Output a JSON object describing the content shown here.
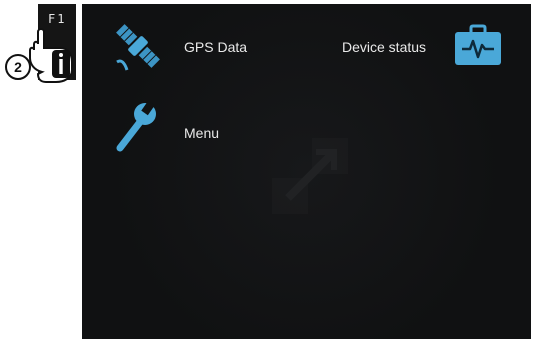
{
  "fkey": {
    "label": "F1",
    "info_symbol": "i"
  },
  "step": {
    "number": "2"
  },
  "menu": {
    "gps_data": {
      "label": "GPS Data",
      "icon": "satellite-icon"
    },
    "device_status": {
      "label": "Device status",
      "icon": "medical-case-icon"
    },
    "menu": {
      "label": "Menu",
      "icon": "wrench-icon"
    }
  },
  "colors": {
    "screen_bg": "#111213",
    "accent_blue": "#4aa8d8",
    "text": "#e9e9e9"
  }
}
